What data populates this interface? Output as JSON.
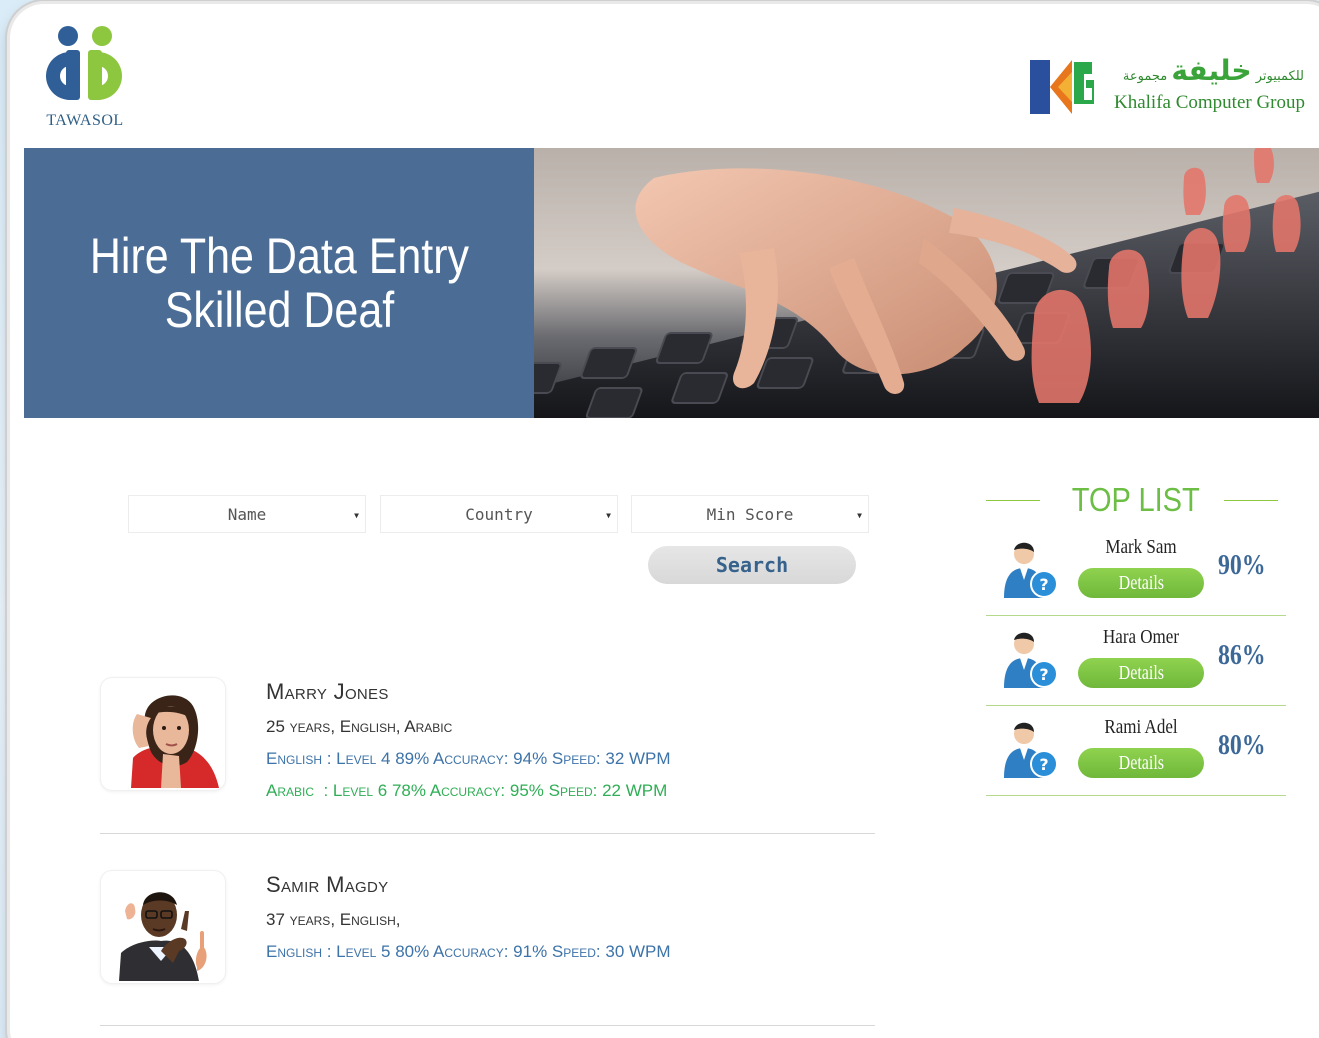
{
  "header": {
    "left_logo": {
      "name": "TAWASOL",
      "icon": "tawasol-logo-icon"
    },
    "right_logo": {
      "arabic_small": "مجموعة",
      "arabic_big": "خليفة",
      "arabic_tail": "للكمبيوتر",
      "english": "Khalifa Computer Group",
      "icon": "kcg-logo-icon"
    }
  },
  "hero": {
    "line1": "Hire The Data Entry",
    "line2": "Skilled Deaf",
    "bg_color": "#4a6c95"
  },
  "search": {
    "filters": [
      {
        "label": "Name"
      },
      {
        "label": "Country"
      },
      {
        "label": "Min Score"
      }
    ],
    "button_label": "Search"
  },
  "results": [
    {
      "name": "Marry Jones",
      "meta": "25 years, English, Arabic",
      "lines": [
        {
          "text": "English : Level 4 89% Accuracy: 94% Speed: 32 WPM",
          "color": "blue"
        },
        {
          "text": "Arabic  : Level 6 78% Accuracy: 95% Speed: 22 WPM",
          "color": "green"
        }
      ]
    },
    {
      "name": "Samir Magdy",
      "meta": "37 years, English,",
      "lines": [
        {
          "text": "English : Level 5 80% Accuracy: 91% Speed: 30 WPM",
          "color": "blue"
        }
      ]
    }
  ],
  "top_list": {
    "title": "TOP LIST",
    "details_label": "Details",
    "items": [
      {
        "name": "Mark Sam",
        "percent": "90%"
      },
      {
        "name": "Hara Omer",
        "percent": "86%"
      },
      {
        "name": "Rami Adel",
        "percent": "80%"
      }
    ]
  },
  "colors": {
    "accent_green": "#6cbe45",
    "accent_blue": "#3d73a8",
    "hero_blue": "#4a6c95"
  }
}
